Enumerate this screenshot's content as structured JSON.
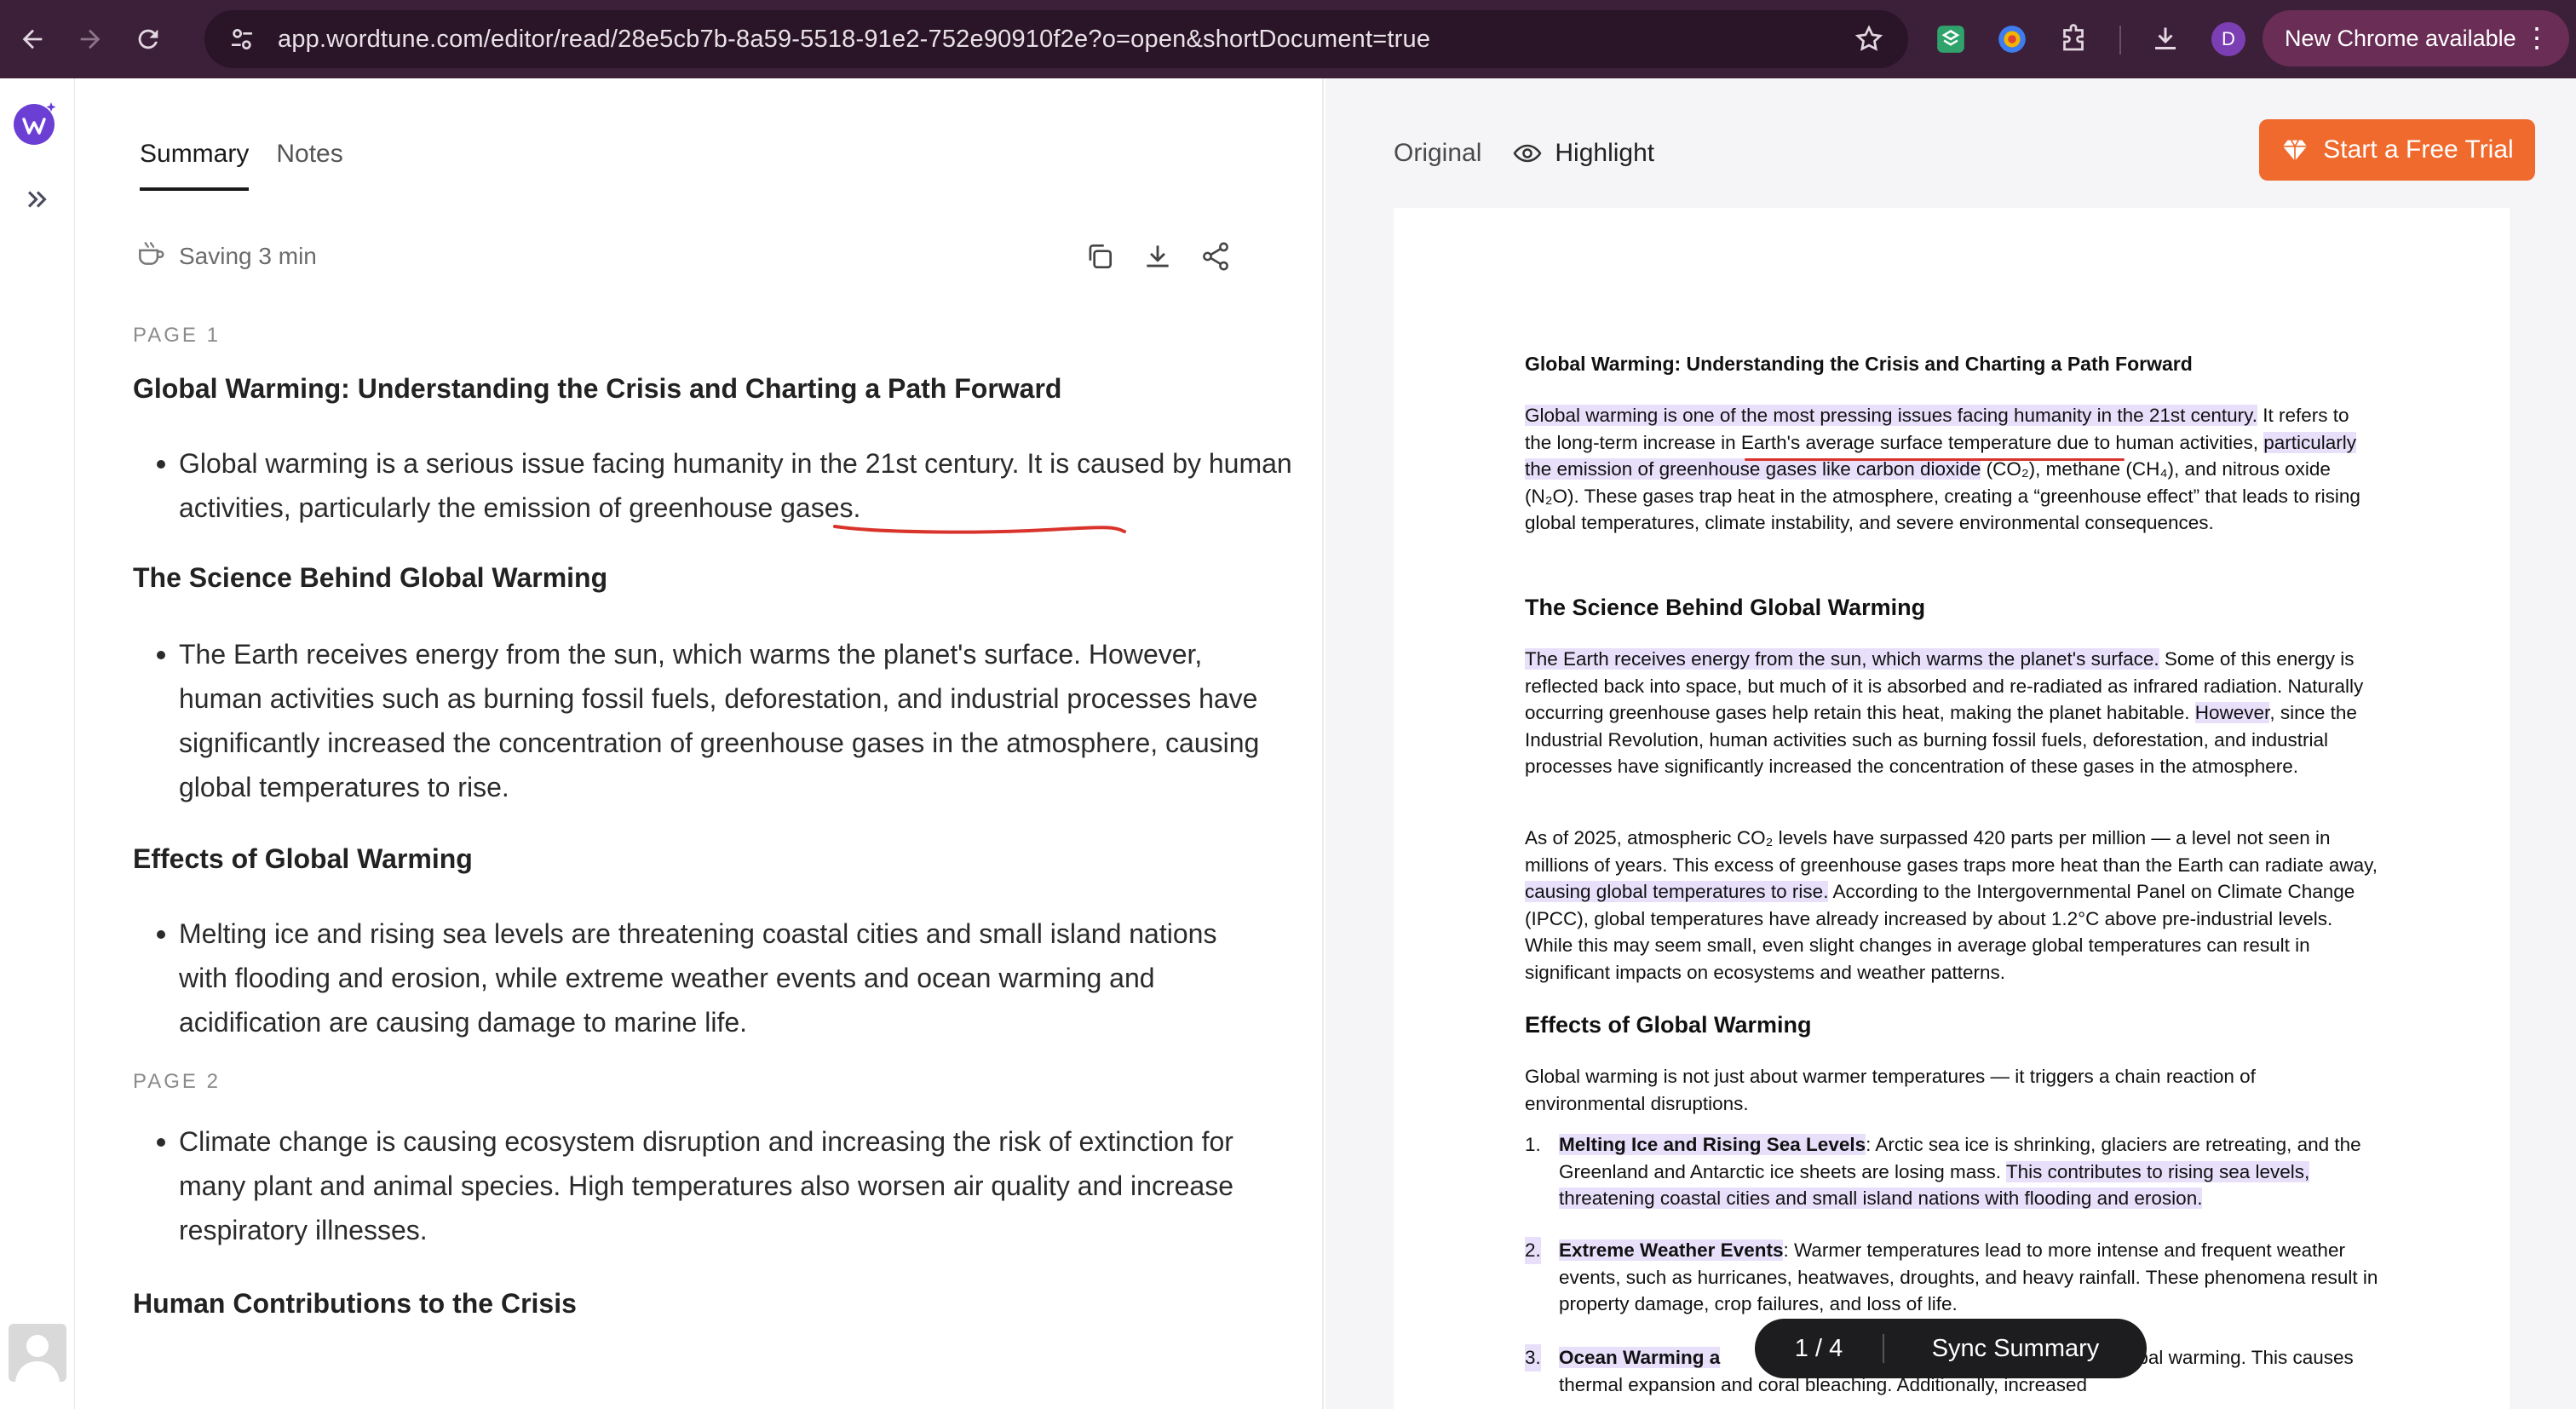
{
  "browser": {
    "url": "app.wordtune.com/editor/read/28e5cb7b-8a59-5518-91e2-752e90910f2e?o=open&shortDocument=true",
    "profile_initial": "D",
    "new_chrome_label": "New Chrome available"
  },
  "summary": {
    "tabs": [
      "Summary",
      "Notes"
    ],
    "saving": "Saving 3 min",
    "page1_label": "PAGE 1",
    "page2_label": "PAGE 2",
    "s1_title": "Global Warming: Understanding the Crisis and Charting a Path Forward",
    "s1_bullet": "Global warming is a serious issue facing humanity in the 21st century. It is caused by human activities, particularly the emission of greenhouse gases.",
    "s2_title": "The Science Behind Global Warming",
    "s2_bullet": "The Earth receives energy from the sun, which warms the planet's surface. However, human activities such as burning fossil fuels, deforestation, and industrial processes have significantly increased the concentration of greenhouse gases in the atmosphere, causing global temperatures to rise.",
    "s3_title": "Effects of Global Warming",
    "s3_bullet": "Melting ice and rising sea levels are threatening coastal cities and small island nations with flooding and erosion, while extreme weather events and ocean warming and acidification are causing damage to marine life.",
    "s4_bullet": "Climate change is causing ecosystem disruption and increasing the risk of extinction for many plant and animal species. High temperatures also worsen air quality and increase respiratory illnesses.",
    "s5_title": "Human Contributions to the Crisis"
  },
  "original": {
    "tab_original": "Original",
    "tab_highlight": "Highlight",
    "trial_label": "Start a Free Trial",
    "doc_title": "Global Warming: Understanding the Crisis and Charting a Path Forward",
    "p1_hl": "Global warming is one of the most pressing issues facing humanity in the 21st century.",
    "p1_rest_a": " It refers to the long-term increase in Earth's average surface temperature due to human activities, ",
    "p1_hl2": "particularly the emission of greenhouse gases like carbon dioxide",
    "p1_rest_b": " (CO₂), methane (CH₄), and nitrous oxide (N₂O). These gases trap heat in the atmosphere, creating a “greenhouse effect” that leads to rising global temperatures, climate instability, and severe environmental consequences.",
    "h_science": "The Science Behind Global Warming",
    "p2_hl": "The Earth receives energy from the sun, which warms the planet's surface.",
    "p2_rest_a": " Some of this energy is reflected back into space, but much of it is absorbed and re-radiated as infrared radiation. Naturally occurring greenhouse gases help retain this heat, making the planet habitable. ",
    "p2_hl2": "However",
    "p2_rest_b": ", since the Industrial Revolution, human activities such as burning fossil fuels, deforestation, and industrial processes have significantly increased the concentration of these gases in the atmosphere.",
    "p3_a": "As of 2025, atmospheric CO₂ levels have surpassed 420 parts per million — a level not seen in millions of years. This excess of greenhouse gases traps more heat than the Earth can radiate away, ",
    "p3_hl": "causing global temperatures to rise.",
    "p3_b": " According to the Intergovernmental Panel on Climate Change (IPCC), global temperatures have already increased by about 1.2°C above pre-industrial levels. While this may seem small, even slight changes in average global temperatures can result in significant impacts on ecosystems and weather patterns.",
    "h_effects": "Effects of Global Warming",
    "p4": "Global warming is not just about warmer temperatures — it triggers a chain reaction of environmental disruptions.",
    "li1_num": "1.",
    "li1_title": "Melting Ice and Rising Sea Levels",
    "li1_a": ": Arctic sea ice is shrinking, glaciers are retreating, and the Greenland and Antarctic ice sheets are losing mass. ",
    "li1_hl": "This contributes to rising sea levels, threatening coastal cities and small island nations with flooding and erosion.",
    "li2_num": "2.",
    "li2_title": "Extreme Weather Events",
    "li2_a": ": Warmer temperatures lead to more intense and frequent weather events, such as hurricanes, heatwaves, droughts, and heavy rainfall. These phenomena result in property damage, crop failures, and loss of life.",
    "li3_num": "3.",
    "li3_title": "Ocean Warming a",
    "li3_a": "% of the heat from global warming. This causes thermal expansion and coral bleaching. Additionally, increased"
  },
  "pager": {
    "page_indicator": "1  /  4",
    "sync_label": "Sync Summary"
  },
  "colors": {
    "chrome_bg": "#3c1f38",
    "accent_orange": "#ef6a2c",
    "highlight_purple": "#e8e0fb",
    "squiggle_red": "#d9342b",
    "brand_purple": "#6b3fd4"
  }
}
